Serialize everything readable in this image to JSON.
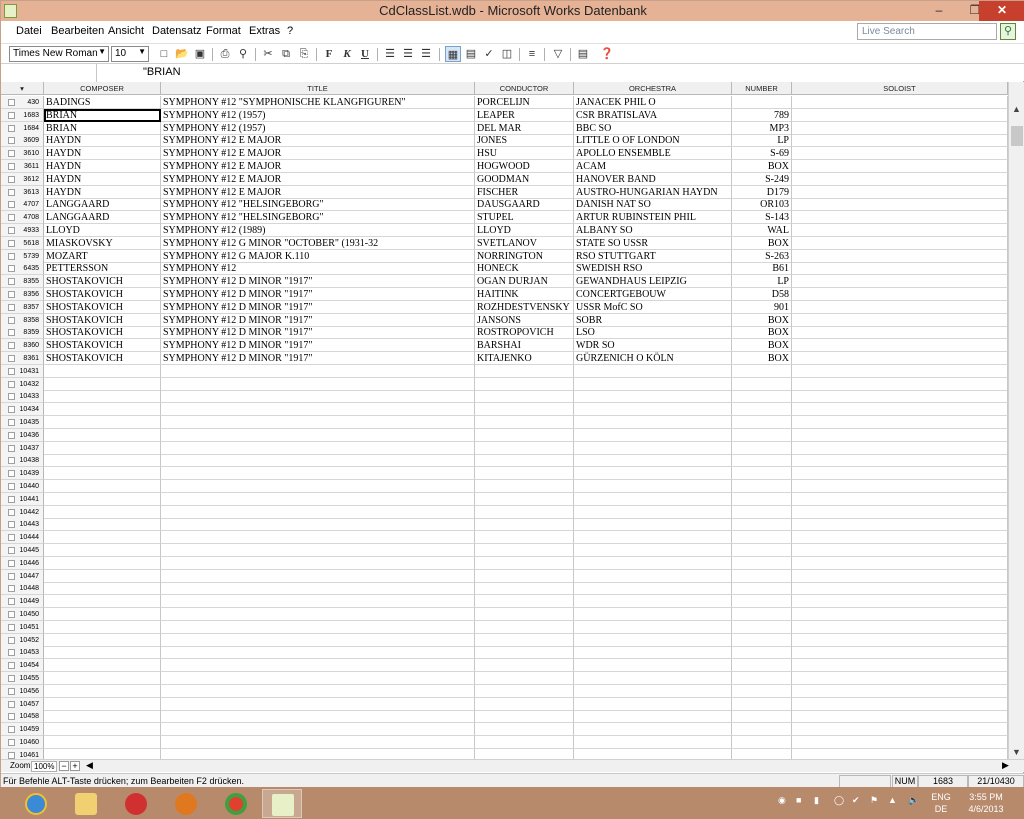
{
  "window": {
    "title": "CdClassList.wdb - Microsoft Works Datenbank",
    "minimize": "–",
    "restore": "❐",
    "close": "✕"
  },
  "menu": [
    "Datei",
    "Bearbeiten",
    "Ansicht",
    "Datensatz",
    "Format",
    "Extras",
    "?"
  ],
  "search": {
    "placeholder": "Live Search",
    "button_icon": "search-icon"
  },
  "toolbar": {
    "font_family": "Times New Roman",
    "font_size": "10",
    "bold": "F",
    "italic": "K",
    "underline": "U"
  },
  "formula": {
    "value": "\"BRIAN"
  },
  "columns": [
    "COMPOSER",
    "TITLE",
    "CONDUCTOR",
    "ORCHESTRA",
    "NUMBER",
    "SOLOIST"
  ],
  "records": [
    {
      "n": "430",
      "composer": "BADINGS",
      "title": "SYMPHONY #12 \"SYMPHONISCHE KLANGFIGUREN\"",
      "conductor": "PORCELIJN",
      "orchestra": "JANACEK PHIL O",
      "number": "",
      "soloist": ""
    },
    {
      "n": "1683",
      "composer": "BRIAN",
      "title": "SYMPHONY #12 (1957)",
      "conductor": "LEAPER",
      "orchestra": "CSR BRATISLAVA",
      "number": "789",
      "soloist": ""
    },
    {
      "n": "1684",
      "composer": "BRIAN",
      "title": "SYMPHONY #12 (1957)",
      "conductor": "DEL MAR",
      "orchestra": "BBC SO",
      "number": "MP3",
      "soloist": ""
    },
    {
      "n": "3609",
      "composer": "HAYDN",
      "title": "SYMPHONY #12 E MAJOR",
      "conductor": "JONES",
      "orchestra": "LITTLE O OF LONDON",
      "number": "LP",
      "soloist": ""
    },
    {
      "n": "3610",
      "composer": "HAYDN",
      "title": "SYMPHONY #12 E MAJOR",
      "conductor": "HSU",
      "orchestra": "APOLLO ENSEMBLE",
      "number": "S-69",
      "soloist": ""
    },
    {
      "n": "3611",
      "composer": "HAYDN",
      "title": "SYMPHONY #12 E MAJOR",
      "conductor": "HOGWOOD",
      "orchestra": "ACAM",
      "number": "BOX",
      "soloist": ""
    },
    {
      "n": "3612",
      "composer": "HAYDN",
      "title": "SYMPHONY #12 E MAJOR",
      "conductor": "GOODMAN",
      "orchestra": "HANOVER BAND",
      "number": "S-249",
      "soloist": ""
    },
    {
      "n": "3613",
      "composer": "HAYDN",
      "title": "SYMPHONY #12 E MAJOR",
      "conductor": "FISCHER",
      "orchestra": "AUSTRO-HUNGARIAN HAYDN",
      "number": "D179",
      "soloist": ""
    },
    {
      "n": "4707",
      "composer": "LANGGAARD",
      "title": "SYMPHONY #12 \"HELSINGEBORG\"",
      "conductor": "DAUSGAARD",
      "orchestra": "DANISH NAT SO",
      "number": "OR103",
      "soloist": ""
    },
    {
      "n": "4708",
      "composer": "LANGGAARD",
      "title": "SYMPHONY #12 \"HELSINGEBORG\"",
      "conductor": "STUPEL",
      "orchestra": "ARTUR RUBINSTEIN PHIL",
      "number": "S-143",
      "soloist": ""
    },
    {
      "n": "4933",
      "composer": "LLOYD",
      "title": "SYMPHONY #12 (1989)",
      "conductor": "LLOYD",
      "orchestra": "ALBANY SO",
      "number": "WAL",
      "soloist": ""
    },
    {
      "n": "5618",
      "composer": "MIASKOVSKY",
      "title": "SYMPHONY #12 G MINOR \"OCTOBER\" (1931-32",
      "conductor": "SVETLANOV",
      "orchestra": "STATE SO USSR",
      "number": "BOX",
      "soloist": ""
    },
    {
      "n": "5739",
      "composer": "MOZART",
      "title": "SYMPHONY #12 G MAJOR K.110",
      "conductor": "NORRINGTON",
      "orchestra": "RSO STUTTGART",
      "number": "S-263",
      "soloist": ""
    },
    {
      "n": "6435",
      "composer": "PETTERSSON",
      "title": "SYMPHONY #12",
      "conductor": "HONECK",
      "orchestra": "SWEDISH RSO",
      "number": "B61",
      "soloist": ""
    },
    {
      "n": "8355",
      "composer": "SHOSTAKOVICH",
      "title": "SYMPHONY #12 D MINOR \"1917\"",
      "conductor": "OGAN DURJAN",
      "orchestra": "GEWANDHAUS LEIPZIG",
      "number": "LP",
      "soloist": ""
    },
    {
      "n": "8356",
      "composer": "SHOSTAKOVICH",
      "title": "SYMPHONY #12 D MINOR \"1917\"",
      "conductor": "HAITINK",
      "orchestra": "CONCERTGEBOUW",
      "number": "D58",
      "soloist": ""
    },
    {
      "n": "8357",
      "composer": "SHOSTAKOVICH",
      "title": "SYMPHONY #12 D MINOR \"1917\"",
      "conductor": "ROZHDESTVENSKY",
      "orchestra": "USSR MofC SO",
      "number": "901",
      "soloist": ""
    },
    {
      "n": "8358",
      "composer": "SHOSTAKOVICH",
      "title": "SYMPHONY #12 D MINOR \"1917\"",
      "conductor": "JANSONS",
      "orchestra": "SOBR",
      "number": "BOX",
      "soloist": ""
    },
    {
      "n": "8359",
      "composer": "SHOSTAKOVICH",
      "title": "SYMPHONY #12 D MINOR \"1917\"",
      "conductor": "ROSTROPOVICH",
      "orchestra": "LSO",
      "number": "BOX",
      "soloist": ""
    },
    {
      "n": "8360",
      "composer": "SHOSTAKOVICH",
      "title": "SYMPHONY #12 D MINOR \"1917\"",
      "conductor": "BARSHAI",
      "orchestra": "WDR SO",
      "number": "BOX",
      "soloist": ""
    },
    {
      "n": "8361",
      "composer": "SHOSTAKOVICH",
      "title": "SYMPHONY #12 D MINOR \"1917\"",
      "conductor": "KITAJENKO",
      "orchestra": "GÜRZENICH O KÖLN",
      "number": "BOX",
      "soloist": ""
    }
  ],
  "empty_rows": [
    "10431",
    "10432",
    "10433",
    "10434",
    "10435",
    "10436",
    "10437",
    "10438",
    "10439",
    "10440",
    "10441",
    "10442",
    "10443",
    "10444",
    "10445",
    "10446",
    "10447",
    "10448",
    "10449",
    "10450",
    "10451",
    "10452",
    "10453",
    "10454",
    "10455",
    "10456",
    "10457",
    "10458",
    "10459",
    "10460",
    "10461"
  ],
  "zoom": {
    "label": "Zoom",
    "value": "100%",
    "minus": "−",
    "plus": "+"
  },
  "status": {
    "message": "Für Befehle ALT-Taste drücken; zum Bearbeiten F2 drücken.",
    "num": "NUM",
    "record": "1683",
    "count": "21/10430"
  },
  "tray": {
    "lang_top": "ENG",
    "lang_bottom": "DE",
    "time": "3:55 PM",
    "date": "4/6/2013"
  },
  "colors": {
    "titlebar": "#e6b296",
    "taskbar": "#b88a6c",
    "close": "#c7402e"
  }
}
